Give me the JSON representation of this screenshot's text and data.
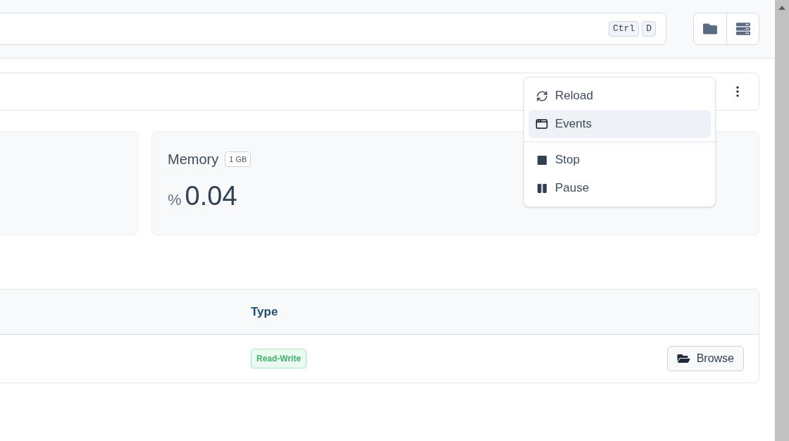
{
  "search": {
    "shortcut_keys": [
      "Ctrl",
      "D"
    ]
  },
  "header_actions": [
    {
      "kind": "folder"
    },
    {
      "kind": "server"
    }
  ],
  "stat_card": {
    "title": "Memory",
    "badge": "1 GB",
    "unit": "%",
    "value": "0.04"
  },
  "menu": {
    "items": [
      {
        "label": "Reload",
        "kind": "reload",
        "selected": false
      },
      {
        "label": "Events",
        "kind": "events",
        "selected": true
      },
      {
        "label": "Stop",
        "kind": "stop",
        "selected": false,
        "divider_before": true
      },
      {
        "label": "Pause",
        "kind": "pause",
        "selected": false
      }
    ]
  },
  "table": {
    "columns": [
      "Type"
    ],
    "rows": [
      {
        "type": "Read-Write",
        "action": "Browse"
      }
    ]
  }
}
